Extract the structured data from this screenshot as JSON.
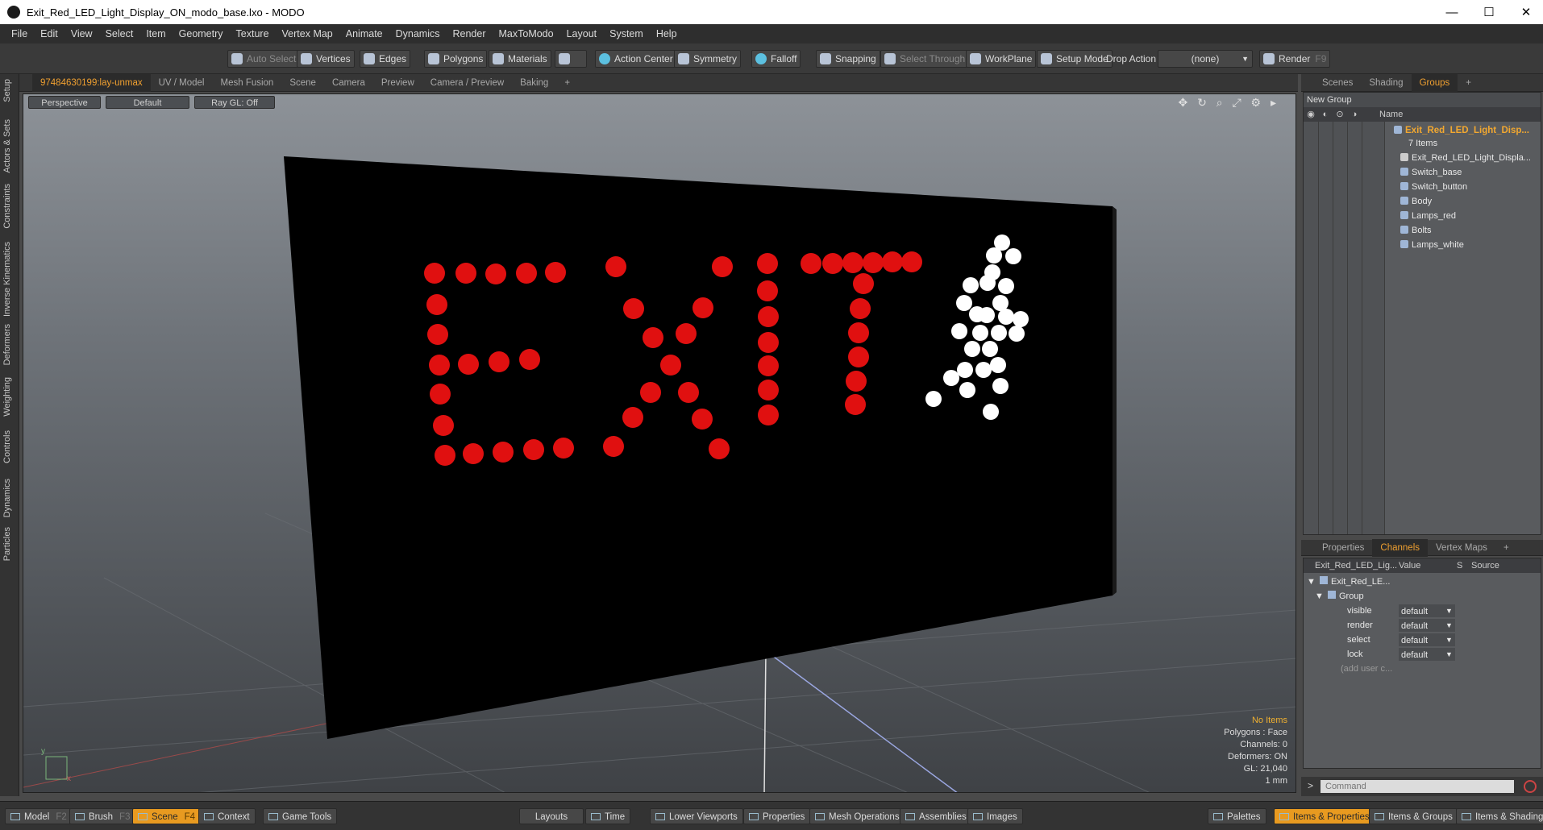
{
  "window": {
    "title": "Exit_Red_LED_Light_Display_ON_modo_base.lxo - MODO",
    "minimize": "—",
    "maximize": "☐",
    "close": "✕"
  },
  "menu": [
    "File",
    "Edit",
    "View",
    "Select",
    "Item",
    "Geometry",
    "Texture",
    "Vertex Map",
    "Animate",
    "Dynamics",
    "Render",
    "MaxToModo",
    "Layout",
    "System",
    "Help"
  ],
  "toolbar": {
    "auto_select": "Auto Select",
    "vertices": "Vertices",
    "edges": "Edges",
    "polygons": "Polygons",
    "materials": "Materials",
    "action_center": "Action Center",
    "symmetry": "Symmetry",
    "falloff": "Falloff",
    "snapping": "Snapping",
    "select_through": "Select Through",
    "workplane": "WorkPlane",
    "setup_mode": "Setup Mode",
    "drop_action": "Drop Action",
    "drop_value": "(none)",
    "render": "Render",
    "render_key": "F9"
  },
  "left_tabs": [
    "Setup",
    "Actors & Sets",
    "Constraints",
    "Inverse Kinematics",
    "Deformers",
    "Weighting",
    "Controls",
    "Dynamics",
    "Particles"
  ],
  "viewport_tabs": [
    "97484630199:lay-unmax",
    "UV / Model",
    "Mesh Fusion",
    "Scene",
    "Camera",
    "Preview",
    "Camera / Preview",
    "Baking",
    "+"
  ],
  "viewport": {
    "projection": "Perspective",
    "shading": "Default",
    "raygl": "Ray GL: Off",
    "nav_icons": "✥ ↻ ⌕ ⤢ ⚙ ▸",
    "info": {
      "no_items": "No Items",
      "polygons": "Polygons : Face",
      "channels": "Channels: 0",
      "deformers": "Deformers: ON",
      "gl": "GL: 21,040",
      "unit": "1 mm"
    }
  },
  "right_tabs_top": [
    "Scenes",
    "Shading",
    "Groups",
    "+"
  ],
  "groups": {
    "new_group": "New Group",
    "name_col": "Name",
    "root": "Exit_Red_LED_Light_Disp...",
    "count": "7 Items",
    "children": [
      "Exit_Red_LED_Light_Displa...",
      "Switch_base",
      "Switch_button",
      "Body",
      "Lamps_red",
      "Bolts",
      "Lamps_white"
    ]
  },
  "right_tabs_bottom": [
    "Properties",
    "Channels",
    "Vertex Maps",
    "+"
  ],
  "channels": {
    "col_name": "Exit_Red_LED_Lig...",
    "col_value": "Value",
    "col_s": "S",
    "col_source": "Source",
    "item": "Exit_Red_LE...",
    "group": "Group",
    "rows": [
      {
        "name": "visible",
        "value": "default"
      },
      {
        "name": "render",
        "value": "default"
      },
      {
        "name": "select",
        "value": "default"
      },
      {
        "name": "lock",
        "value": "default"
      }
    ],
    "add_user": "(add user c..."
  },
  "command": {
    "prompt": ">",
    "placeholder": "Command"
  },
  "bottom": {
    "model": "Model",
    "model_key": "F2",
    "brush": "Brush",
    "brush_key": "F3",
    "scene": "Scene",
    "scene_key": "F4",
    "context": "Context",
    "game_tools": "Game Tools",
    "layouts": "Layouts",
    "time": "Time",
    "lower_viewports": "Lower Viewports",
    "properties": "Properties",
    "mesh_operations": "Mesh Operations",
    "assemblies": "Assemblies",
    "images": "Images",
    "palettes": "Palettes",
    "items_properties": "Items & Properties",
    "items_groups": "Items & Groups",
    "items_shading": "Items & Shading"
  },
  "colors": {
    "accent": "#e89a20",
    "led_red": "#e01010",
    "led_white": "#ffffff",
    "sign_body": "#000000"
  }
}
